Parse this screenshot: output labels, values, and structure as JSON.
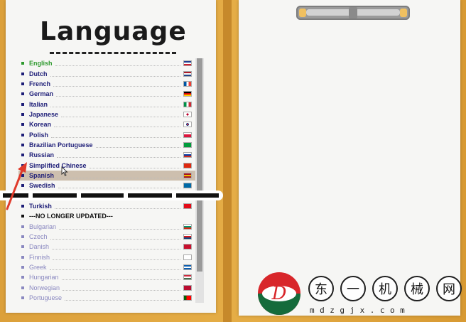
{
  "title": "Language",
  "languages": [
    {
      "label": "English",
      "state": "active",
      "flag": "uk"
    },
    {
      "label": "Dutch",
      "flag": "nl"
    },
    {
      "label": "French",
      "flag": "fr"
    },
    {
      "label": "German",
      "flag": "de"
    },
    {
      "label": "Italian",
      "flag": "it"
    },
    {
      "label": "Japanese",
      "flag": "jp"
    },
    {
      "label": "Korean",
      "flag": "kr"
    },
    {
      "label": "Polish",
      "flag": "pl"
    },
    {
      "label": "Brazilian Portuguese",
      "flag": "br"
    },
    {
      "label": "Russian",
      "flag": "ru"
    },
    {
      "label": "Simplified Chinese",
      "flag": "cn"
    },
    {
      "label": "Spanish",
      "state": "highlight",
      "flag": "es"
    },
    {
      "label": "Swedish",
      "flag": "se"
    },
    {
      "label": "",
      "state": "gap",
      "flag": ""
    },
    {
      "label": "Turkish",
      "flag": "tr"
    },
    {
      "label": "---NO LONGER UPDATED---",
      "state": "separator",
      "flag": ""
    },
    {
      "label": "Bulgarian",
      "state": "deprecated",
      "flag": "bg"
    },
    {
      "label": "Czech",
      "state": "deprecated",
      "flag": "cz"
    },
    {
      "label": "Danish",
      "state": "deprecated",
      "flag": "dk"
    },
    {
      "label": "Finnish",
      "state": "deprecated",
      "flag": "fi"
    },
    {
      "label": "Greek",
      "state": "deprecated",
      "flag": "gr"
    },
    {
      "label": "Hungarian",
      "state": "deprecated",
      "flag": "hu"
    },
    {
      "label": "Norwegian",
      "state": "deprecated",
      "flag": "no"
    },
    {
      "label": "Portuguese",
      "state": "deprecated",
      "flag": "pt"
    }
  ],
  "watermark": {
    "chars": [
      "东",
      "一",
      "机",
      "械",
      "网"
    ],
    "url": "mdzgjx.com"
  },
  "colors": {
    "folder": "#e3a83a",
    "paper": "#f6f6f4",
    "list_text": "#1e1e78",
    "active": "#2e9a2e",
    "highlight": "#cdbfae",
    "deprecated": "#8a88c0",
    "annotation_arrow": "#e03a2a"
  }
}
